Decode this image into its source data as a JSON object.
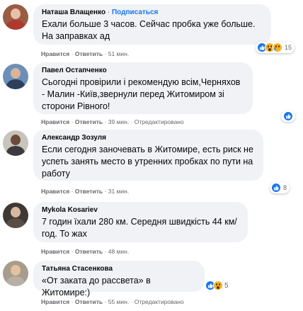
{
  "comments": [
    {
      "author": "Наташа Влащенко",
      "follow_label": "Подписаться",
      "text": "Ехали больше 3 часов. Сейчас пробка уже больше. На заправках ад",
      "like_label": "Нравится",
      "reply_label": "Ответить",
      "time": "51 мин.",
      "reaction_count": "15",
      "reactions": [
        "like-icon",
        "wow-icon",
        "sad-icon"
      ]
    },
    {
      "author": "Павел Остапченко",
      "text": "Сьогодні провірили і рекомендую всім,Черняхов - Малин -Київ,звернули перед Житомиром зі сторони Рівного!",
      "like_label": "Нравится",
      "reply_label": "Ответить",
      "time": "39 мин.",
      "edited": "Отредактировано",
      "reaction_count": "",
      "reactions": [
        "like-icon"
      ]
    },
    {
      "author": "Александр Зозуля",
      "text": "Если сегодня заночевать в Житомире, есть риск не успеть занять место в утренних пробках по пути на работу",
      "like_label": "Нравится",
      "reply_label": "Ответить",
      "time": "31 мин.",
      "reaction_count": "8",
      "reactions": [
        "like-icon"
      ]
    },
    {
      "author": "Mykola Kosariev",
      "text": "7 годин їхали 280 км. Середня швидкість 44 км/год. То жах",
      "like_label": "Нравится",
      "reply_label": "Ответить",
      "time": "48 мин."
    },
    {
      "author": "Татьяна Стасенкова",
      "text": "«От заката до рассвета» в Житомире:)",
      "like_label": "Нравится",
      "reply_label": "Ответить",
      "time": "55 мин.",
      "edited": "Отредактировано",
      "reaction_count": "5",
      "reactions": [
        "like-icon",
        "wow-icon"
      ]
    }
  ],
  "separator": "·",
  "colors": {
    "bubble_bg": "#f0f2f5",
    "follow_blue": "#1877f2",
    "meta_gray": "#65676b",
    "like_blue": "#1877f2",
    "emoji_yellow": "#f7b125"
  }
}
